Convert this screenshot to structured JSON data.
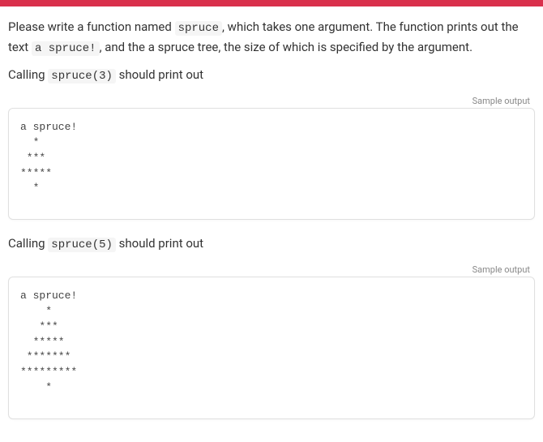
{
  "intro": {
    "part1": "Please write a function named ",
    "code1": "spruce",
    "part2": ", which takes one argument. The function prints out the text ",
    "code2": "a spruce!",
    "part3": ", and the a spruce tree, the size of which is specified by the argument."
  },
  "call1": {
    "prefix": "Calling ",
    "code": "spruce(3)",
    "suffix": " should print out"
  },
  "sample_label": "Sample output",
  "output1": "a spruce!\n  *\n ***\n*****\n  *",
  "call2": {
    "prefix": "Calling ",
    "code": "spruce(5)",
    "suffix": " should print out"
  },
  "output2": "a spruce!\n    *\n   ***\n  *****\n *******\n*********\n    *"
}
